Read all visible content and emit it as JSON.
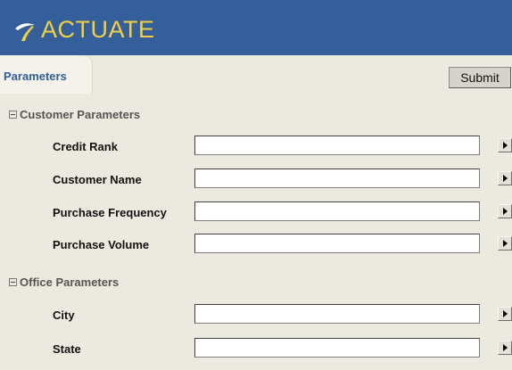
{
  "header": {
    "logo_text": "ACTUATE",
    "logo_icon": "actuate-swoosh-icon"
  },
  "tabs": [
    {
      "label": "Parameters"
    }
  ],
  "toolbar": {
    "submit_label": "Submit"
  },
  "sections": [
    {
      "title": "Customer Parameters",
      "expanded": true,
      "fields": [
        {
          "label": "Credit Rank",
          "value": ""
        },
        {
          "label": "Customer Name",
          "value": ""
        },
        {
          "label": "Purchase Frequency",
          "value": ""
        },
        {
          "label": "Purchase Volume",
          "value": ""
        }
      ]
    },
    {
      "title": "Office Parameters",
      "expanded": true,
      "fields": [
        {
          "label": "City",
          "value": ""
        },
        {
          "label": "State",
          "value": ""
        }
      ]
    }
  ],
  "colors": {
    "header_bg": "#355f9b",
    "logo": "#f3d043",
    "page_bg": "#eceae0",
    "tab_label": "#2d5f97"
  }
}
